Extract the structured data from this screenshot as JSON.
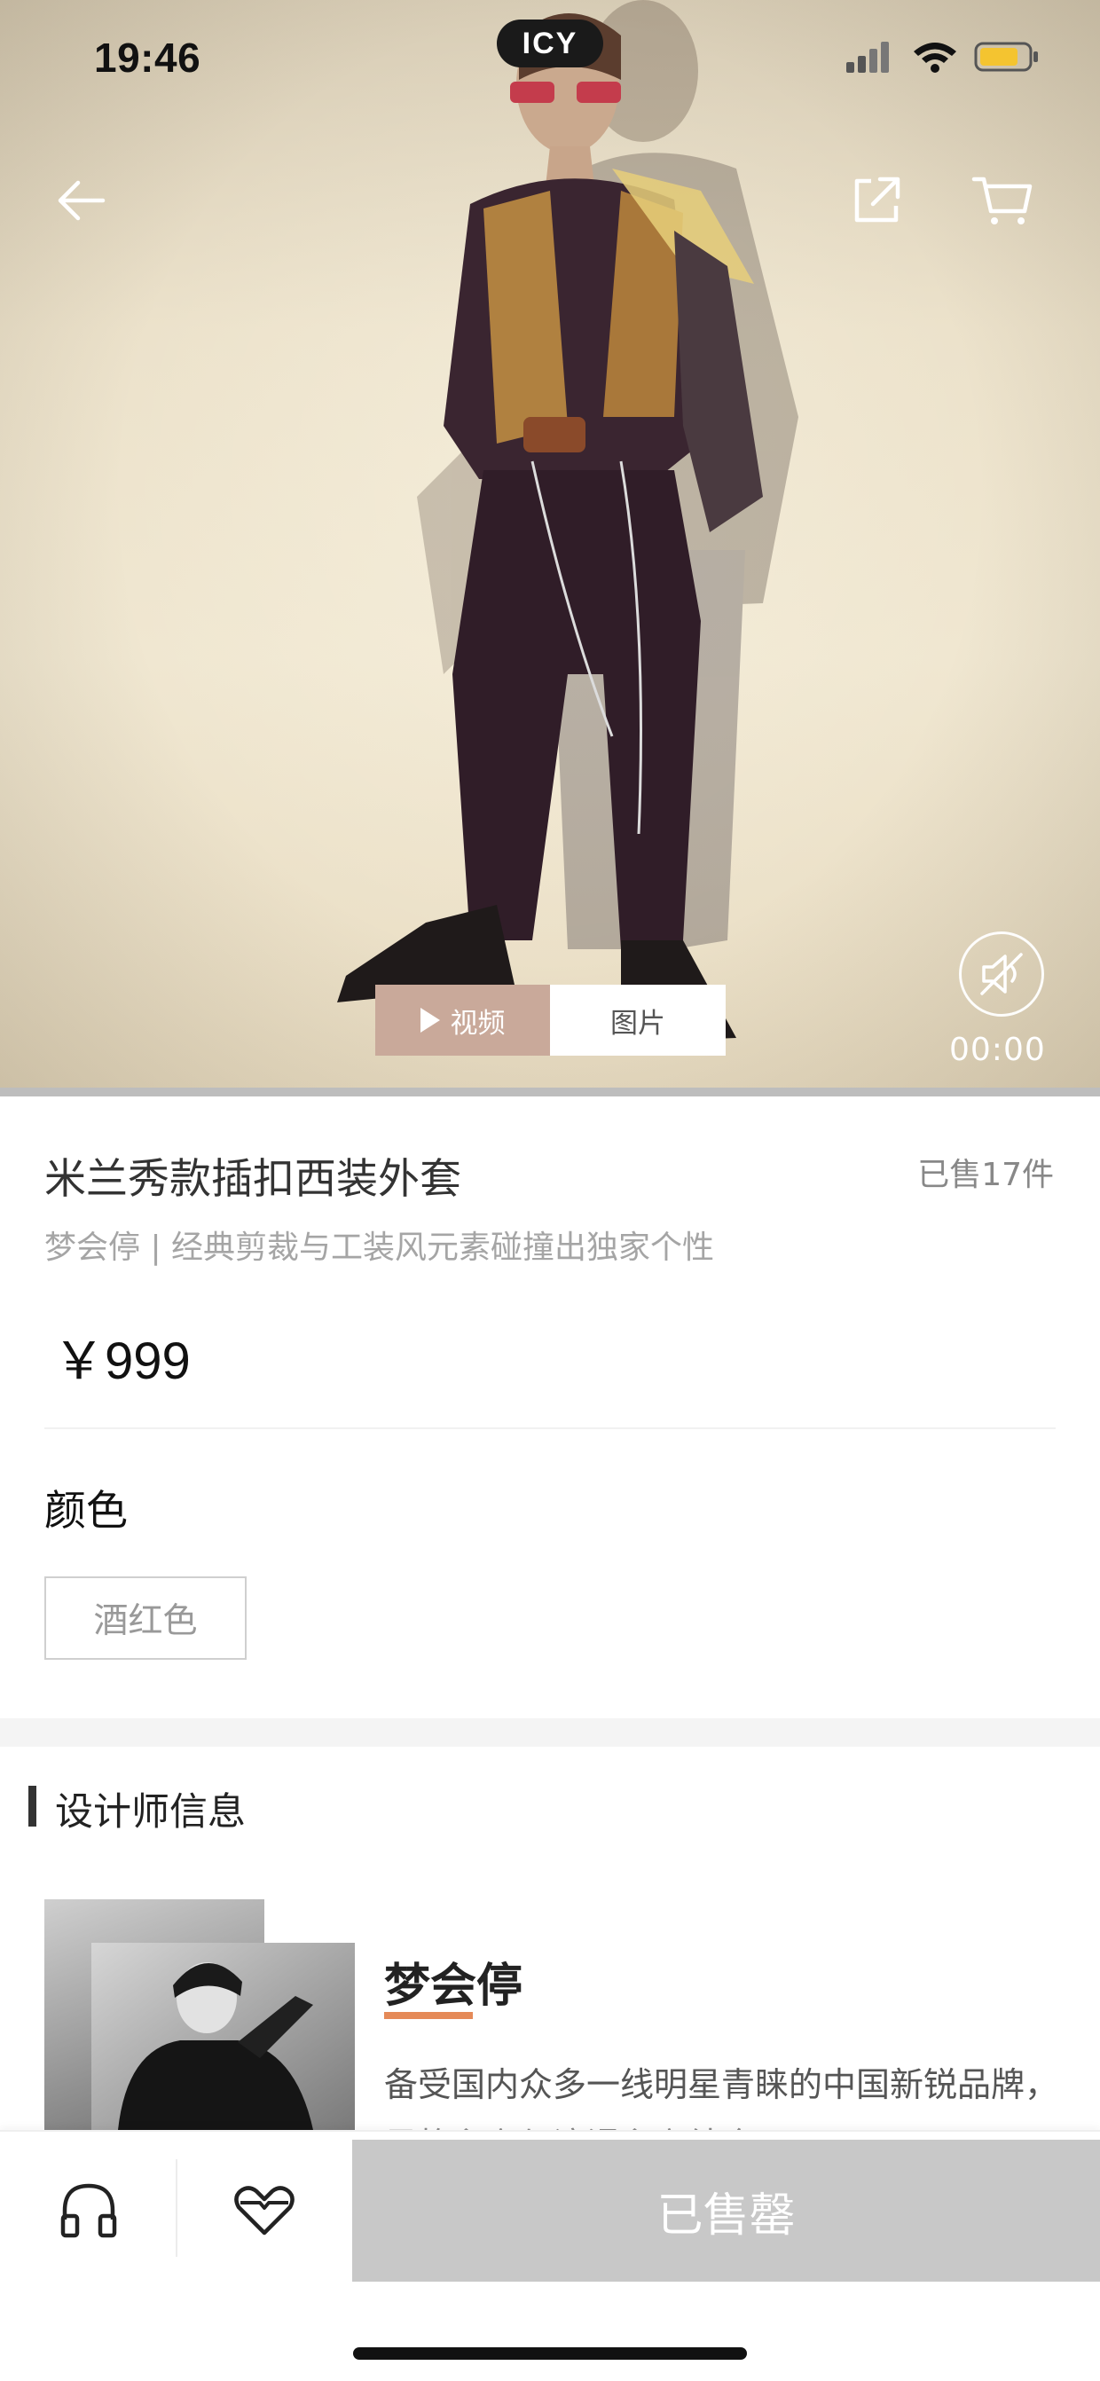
{
  "status_bar": {
    "time": "19:46",
    "app_pill": "ICY",
    "icons": [
      "signal-icon",
      "wifi-icon",
      "battery-icon"
    ]
  },
  "nav": {
    "icons": [
      "back-arrow-icon",
      "share-icon",
      "cart-icon"
    ]
  },
  "media": {
    "tabs": [
      {
        "label": "视频",
        "selected": true
      },
      {
        "label": "图片",
        "selected": false
      }
    ],
    "video_time": "00:00",
    "mute_icon": "mute-icon"
  },
  "product": {
    "title": "米兰秀款插扣西装外套",
    "sold": "已售17件",
    "subtitle": "梦会停 | 经典剪裁与工装风元素碰撞出独家个性",
    "price": "￥999"
  },
  "color_section": {
    "label": "颜色",
    "options": [
      "酒红色"
    ]
  },
  "designer": {
    "section_title": "设计师信息",
    "name": "梦会停",
    "bio_line1": "备受国内众多一线明星青睐的中国新锐品牌，",
    "bio_line2": "风格主义与浪漫主义结合"
  },
  "bottom_bar": {
    "icons": [
      "headphones-icon",
      "heart-icon"
    ],
    "action_label": "已售罄"
  },
  "colors": {
    "accent_underline": "#e58a58",
    "video_tab": "#c9a99a",
    "soldout_button": "#c8c8c8"
  }
}
